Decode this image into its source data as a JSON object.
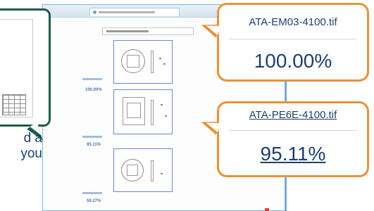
{
  "zoom_caption": {
    "line1": "d a",
    "line2": "you"
  },
  "thumbnails": [
    {
      "similarity": "100.00%"
    },
    {
      "similarity": "95.11%"
    },
    {
      "similarity": "59.27%"
    }
  ],
  "results": [
    {
      "file_name": "ATA-EM03-4100.tif",
      "similarity": "100.00%"
    },
    {
      "file_name": "ATA-PE6E-4100.tif",
      "similarity": "95.11%"
    }
  ],
  "colors": {
    "callout_border": "#e8913a",
    "zoom_border": "#1f5b4e",
    "text": "#1e3f6e"
  }
}
